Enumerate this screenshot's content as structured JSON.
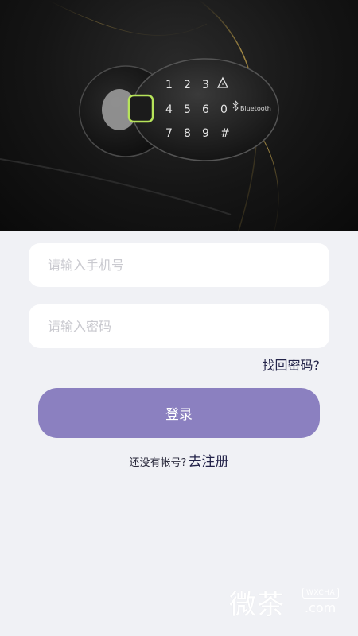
{
  "hero": {
    "keypad": {
      "row1": [
        "1",
        "2",
        "3"
      ],
      "row2": [
        "4",
        "5",
        "6",
        "0"
      ],
      "row3": [
        "7",
        "8",
        "9",
        "#"
      ],
      "brand": "Bluetooth"
    }
  },
  "form": {
    "phone_placeholder": "请输入手机号",
    "password_placeholder": "请输入密码",
    "forgot_label": "找回密码?",
    "login_label": "登录",
    "no_account_text": "还没有帐号?",
    "register_label": "去注册"
  },
  "watermark": {
    "main": "微茶",
    "badge": "WXCHA",
    "domain": ".com"
  },
  "colors": {
    "background": "#f0f1f5",
    "button": "#8b80c0",
    "link": "#232349",
    "placeholder": "#c9c9cf"
  }
}
